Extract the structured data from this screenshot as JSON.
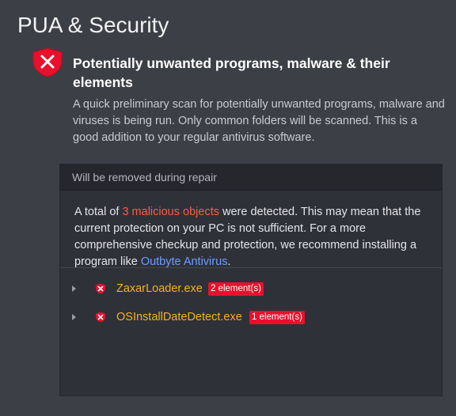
{
  "page_title": "PUA & Security",
  "section": {
    "heading": "Potentially unwanted programs, malware & their elements",
    "description": "A quick preliminary scan for potentially unwanted programs, malware and viruses is being run. Only common folders will be scanned. This is a good addition to your regular antivirus software.",
    "icon": "shield-x-icon"
  },
  "panel": {
    "header": "Will be removed during repair",
    "message_prefix": "A total of ",
    "message_count": "3 malicious objects",
    "message_middle": " were detected. This may mean that the current protection on your PC is not sufficient. For a more comprehensive checkup and protection, we recommend installing a program like ",
    "message_link": "Outbyte Antivirus",
    "message_suffix": "."
  },
  "threats": [
    {
      "name": "ZaxarLoader.exe",
      "badge": "2 element(s)"
    },
    {
      "name": "OSInstallDateDetect.exe",
      "badge": "1 element(s)"
    }
  ],
  "colors": {
    "background": "#3d3f47",
    "panel": "#2f3138",
    "alert_red": "#ff5a45",
    "link": "#6c9dff",
    "threat_name": "#f5b21e",
    "badge": "#e8102d"
  }
}
